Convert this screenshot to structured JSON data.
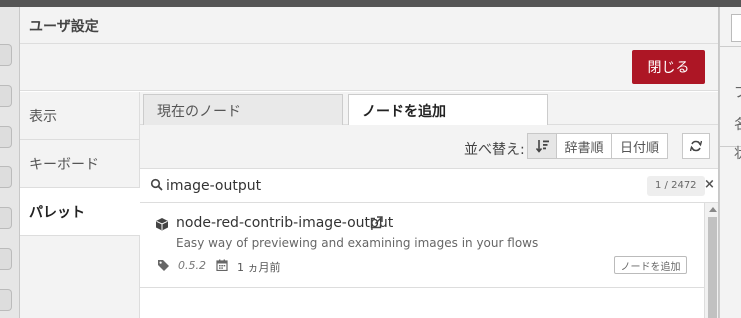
{
  "dialog": {
    "title": "ユーザ設定",
    "close_label": "閉じる"
  },
  "sidenav": {
    "items": [
      {
        "label": "表示"
      },
      {
        "label": "キーボード"
      },
      {
        "label": "パレット"
      }
    ]
  },
  "tabs": [
    {
      "label": "現在のノード"
    },
    {
      "label": "ノードを追加"
    }
  ],
  "sort": {
    "label": "並べ替え:",
    "options": [
      "辞書順",
      "日付順"
    ]
  },
  "search": {
    "value": "image-output",
    "count": "1 / 2472",
    "clear": "×"
  },
  "results": [
    {
      "name": "node-red-contrib-image-output",
      "description": "Easy way of previewing and examining images in your flows",
      "version": "0.5.2",
      "date": "1 ヵ月前",
      "add_label": "ノードを追加"
    }
  ],
  "background": {
    "right_chars": [
      "プ",
      "名",
      "状"
    ]
  },
  "colors": {
    "accent": "#ad1625"
  }
}
